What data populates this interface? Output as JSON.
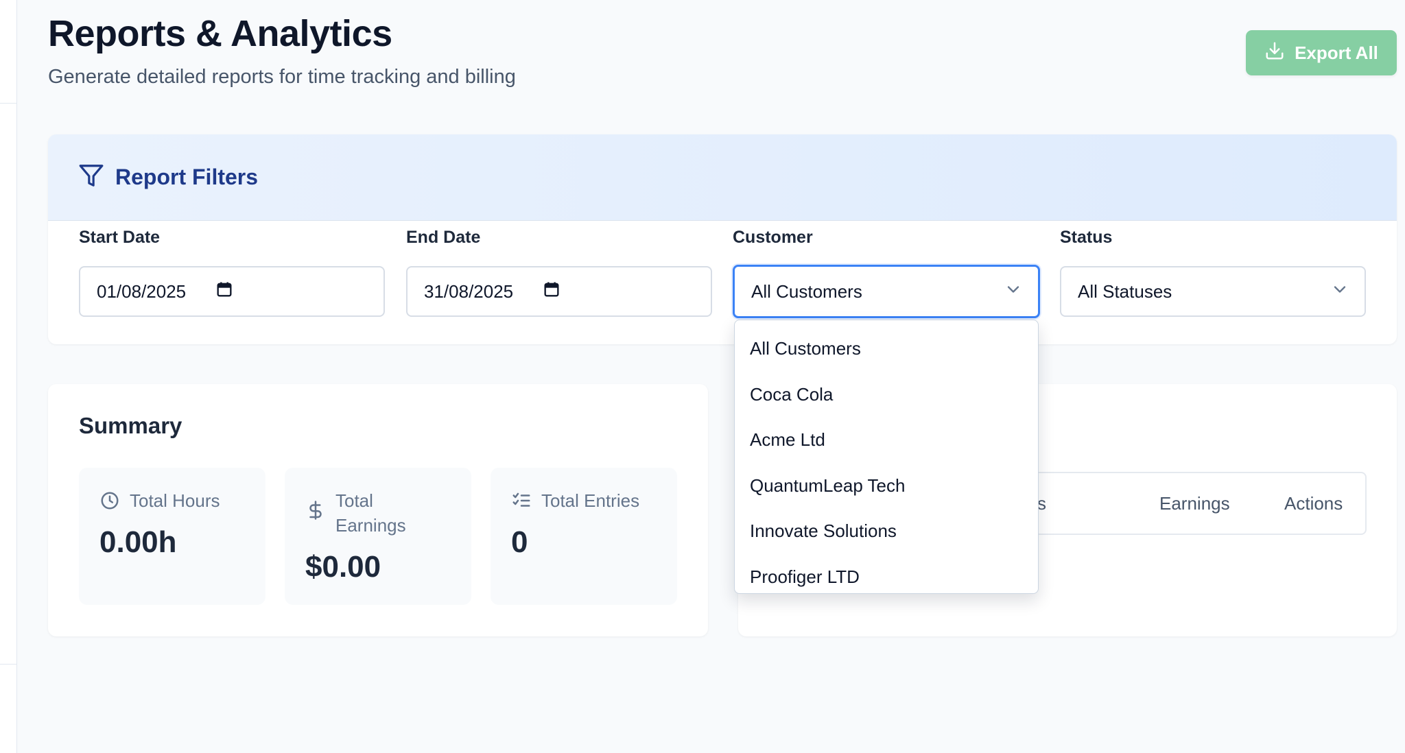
{
  "page": {
    "title": "Reports & Analytics",
    "subtitle": "Generate detailed reports for time tracking and billing"
  },
  "toolbar": {
    "export_label": "Export All",
    "export_icon": "download-icon"
  },
  "filters": {
    "title": "Report Filters",
    "icon": "filter-icon",
    "start_date": {
      "label": "Start Date",
      "value": "01/08/2025"
    },
    "end_date": {
      "label": "End Date",
      "value": "31/08/2025"
    },
    "customer": {
      "label": "Customer",
      "value": "All Customers"
    },
    "status": {
      "label": "Status",
      "value": "All Statuses"
    }
  },
  "customer_dropdown": {
    "options": [
      "All Customers",
      "Coca Cola",
      "Acme Ltd",
      "QuantumLeap Tech",
      "Innovate Solutions",
      "Proofiger LTD"
    ]
  },
  "summary": {
    "title": "Summary",
    "stats": [
      {
        "label": "Total Hours",
        "value": "0.00h",
        "icon": "clock-icon"
      },
      {
        "label": "Total Earnings",
        "value": "$0.00",
        "icon": "dollar-icon"
      },
      {
        "label": "Total Entries",
        "value": "0",
        "icon": "list-checks-icon"
      }
    ]
  },
  "table": {
    "headers": [
      "s",
      "Earnings",
      "Actions"
    ]
  },
  "colors": {
    "export_button": "#86cfa3",
    "filter_header": "#deebfd",
    "filter_title": "#1e3a8a",
    "focus_ring": "#3b82f6"
  }
}
